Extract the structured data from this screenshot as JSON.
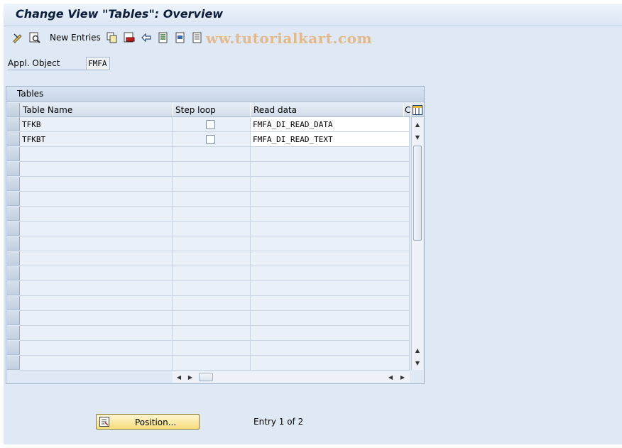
{
  "title": "Change View \"Tables\": Overview",
  "toolbar": {
    "new_entries_label": "New Entries",
    "watermark": "ww.tutorialkart.com"
  },
  "appl_object": {
    "label": "Appl. Object",
    "value": "FMFA"
  },
  "table": {
    "title": "Tables",
    "columns": [
      "Table Name",
      "Step loop",
      "Read data",
      "C"
    ],
    "rows": [
      {
        "table_name": "TFKB",
        "step_loop": false,
        "read_data": "FMFA_DI_READ_DATA"
      },
      {
        "table_name": "TFKBT",
        "step_loop": false,
        "read_data": "FMFA_DI_READ_TEXT"
      }
    ]
  },
  "footer": {
    "position_label": "Position...",
    "entry_info": "Entry 1 of 2"
  },
  "colors": {
    "background": "#dfe9f5",
    "button_yellow": "#f7dd7a",
    "watermark": "#e4b88a"
  }
}
